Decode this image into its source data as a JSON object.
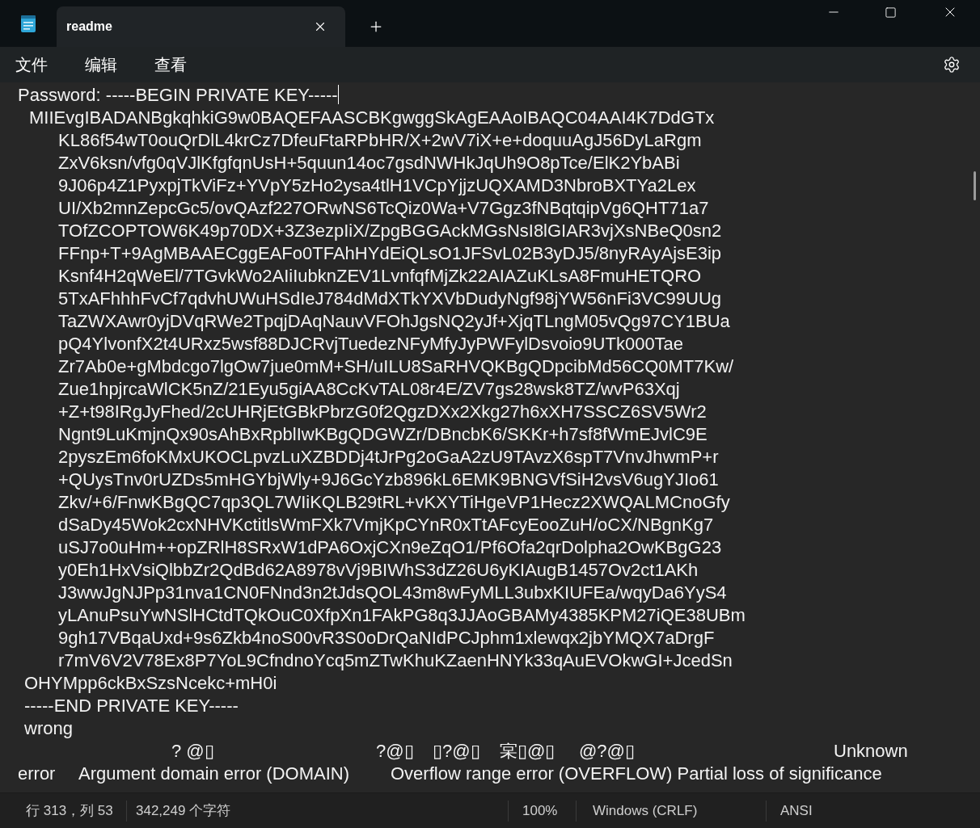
{
  "tabs": [
    {
      "title": "readme",
      "selected": true
    }
  ],
  "menu": [
    "文件",
    "编辑",
    "查看"
  ],
  "editor": {
    "lines": [
      {
        "kind": "first",
        "text": "Password: -----BEGIN PRIVATE KEY-----",
        "caret": true
      },
      {
        "kind": "lead",
        "text": "MIIEvgIBADANBgkqhkiG9w0BAQEFAASCBKgwggSkAgEAAoIBAQC04AAI4K7DdGTx"
      },
      {
        "kind": "body",
        "text": "KL86f54wT0ouQrDlL4krCz7DfeuFtaRPbHR/X+2wV7iX+e+doquuAgJ56DyLaRgm"
      },
      {
        "kind": "body",
        "text": "ZxV6ksn/vfg0qVJlKfgfqnUsH+5quun14oc7gsdNWHkJqUh9O8pTce/ElK2YbABi"
      },
      {
        "kind": "body",
        "text": "9J06p4Z1PyxpjTkViFz+YVpY5zHo2ysa4tlH1VCpYjjzUQXAMD3NbroBXTYa2Lex"
      },
      {
        "kind": "body",
        "text": "UI/Xb2mnZepcGc5/ovQAzf227ORwNS6TcQiz0Wa+V7Ggz3fNBqtqipVg6QHT71a7"
      },
      {
        "kind": "body",
        "text": "TOfZCOPTOW6K49p70DX+3Z3ezpIiX/ZpgBGGAckMGsNsI8lGIAR3vjXsNBeQ0sn2"
      },
      {
        "kind": "body",
        "text": "FFnp+T+9AgMBAAECggEAFo0TFAhHYdEiQLsO1JFSvL02B3yDJ5/8nyRAyAjsE3ip"
      },
      {
        "kind": "body",
        "text": "Ksnf4H2qWeEl/7TGvkWo2AIiIubknZEV1LvnfqfMjZk22AIAZuKLsA8FmuHETQRO"
      },
      {
        "kind": "body",
        "text": "5TxAFhhhFvCf7qdvhUWuHSdIeJ784dMdXTkYXVbDudyNgf98jYW56nFi3VC99UUg"
      },
      {
        "kind": "body",
        "text": "TaZWXAwr0yjDVqRWe2TpqjDAqNauvVFOhJgsNQ2yJf+XjqTLngM05vQg97CY1BUa"
      },
      {
        "kind": "body",
        "text": "pQ4YlvonfX2t4URxz5wsf88DJCRvjTuedezNFyMfyJyPWFylDsvoio9UTk000Tae"
      },
      {
        "kind": "body",
        "text": "Zr7Ab0e+gMbdcgo7lgOw7jue0mM+SH/uILU8SaRHVQKBgQDpcibMd56CQ0MT7Kw/"
      },
      {
        "kind": "body",
        "text": "Zue1hpjrcaWlCK5nZ/21Eyu5giAA8CcKvTAL08r4E/ZV7gs28wsk8TZ/wvP63Xqj"
      },
      {
        "kind": "body",
        "text": "+Z+t98IRgJyFhed/2cUHRjEtGBkPbrzG0f2QgzDXx2Xkg27h6xXH7SSCZ6SV5Wr2"
      },
      {
        "kind": "body",
        "text": "Ngnt9LuKmjnQx90sAhBxRpblIwKBgQDGWZr/DBncbK6/SKKr+h7sf8fWmEJvlC9E"
      },
      {
        "kind": "body",
        "text": "2pyszEm6foKMxUKOCLpvzLuXZBDDj4tJrPg2oGaA2zU9TAvzX6spT7VnvJhwmP+r"
      },
      {
        "kind": "body",
        "text": "+QUysTnv0rUZDs5mHGYbjWly+9J6GcYzb896kL6EMK9BNGVfSiH2vsV6ugYJIo61"
      },
      {
        "kind": "body",
        "text": "Zkv/+6/FnwKBgQC7qp3QL7WIiKQLB29tRL+vKXYTiHgeVP1Hecz2XWQALMCnoGfy"
      },
      {
        "kind": "body",
        "text": "dSaDy45Wok2cxNHVKctitlsWmFXk7VmjKpCYnR0xTtAFcyEooZuH/oCX/NBgnKg7"
      },
      {
        "kind": "body",
        "text": "uSJ7o0uHm++opZRlH8SRxW1dPA6OxjCXn9eZqO1/Pf6Ofa2qrDolpha2OwKBgG23"
      },
      {
        "kind": "body",
        "text": "y0Eh1HxVsiQlbbZr2QdBd62A8978vVj9BIWhS3dZ26U6yKIAugB1457Ov2ct1AKh"
      },
      {
        "kind": "body",
        "text": "J3wwJgNJPp31nva1CN0FNnd3n2tJdsQOL43m8wFyMLL3ubxKIUFEa/wqyDa6YyS4"
      },
      {
        "kind": "body",
        "text": "yLAnuPsuYwNSlHCtdTQkOuC0XfpXn1FAkPG8q3JJAoGBAMy4385KPM27iQE38UBm"
      },
      {
        "kind": "body",
        "text": "9gh17VBqaUxd+9s6Zkb4noS00vR3S0oDrQaNIdPCJphm1xlewqx2jbYMQX7aDrgF"
      },
      {
        "kind": "body",
        "text": "r7mV6V2V78Ex8P7YoL9CfndnoYcq5mZTwKhuKZaenHNYk33qAuEVOkwGI+JcedSn"
      },
      {
        "kind": "tail",
        "text": "OHYMpp6ckBxSzsNcekc+mH0i"
      },
      {
        "kind": "tail",
        "text": "-----END PRIVATE KEY-----"
      },
      {
        "kind": "tail",
        "text": "wrong"
      },
      {
        "kind": "spread",
        "segments": [
          "? @▯",
          "?@▯",
          "▯?@▯",
          "宲▯@▯",
          "@?@▯",
          "Unknown"
        ]
      },
      {
        "kind": "split",
        "segments": [
          "error",
          "Argument domain error (DOMAIN)",
          "Overflow range error (OVERFLOW) Partial loss of significance"
        ]
      }
    ]
  },
  "status_bar": {
    "position": "行 313，列 53",
    "characters": "342,249 个字符",
    "zoom": "100%",
    "line_ending": "Windows (CRLF)",
    "encoding": "ANSI"
  }
}
